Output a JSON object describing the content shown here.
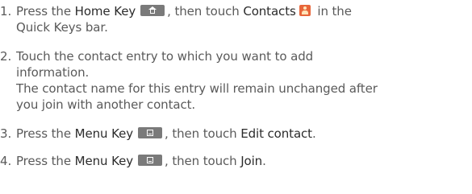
{
  "steps": [
    {
      "number": "1.",
      "line1": {
        "pre": "Press the ",
        "key": "Home Key",
        "mid": ", then touch ",
        "key2": "Contacts",
        "post": " in the"
      },
      "line2": "Quick Keys bar."
    },
    {
      "number": "2.",
      "line1": "Touch the contact entry to which you want to add",
      "line2": "information.",
      "line3": "The contact name for this entry will remain unchanged after",
      "line4": "you join with another contact."
    },
    {
      "number": "3.",
      "line1": {
        "pre": "Press the ",
        "key": "Menu Key",
        "mid": ", then touch ",
        "key2": "Edit contact",
        "post": "."
      }
    },
    {
      "number": "4.",
      "line1": {
        "pre": "Press the ",
        "key": "Menu Key",
        "mid": ", then touch ",
        "key2": "Join",
        "post": "."
      }
    }
  ],
  "icons": {
    "home": "home-key-icon",
    "contacts": "contacts-app-icon",
    "menu": "menu-key-icon"
  }
}
